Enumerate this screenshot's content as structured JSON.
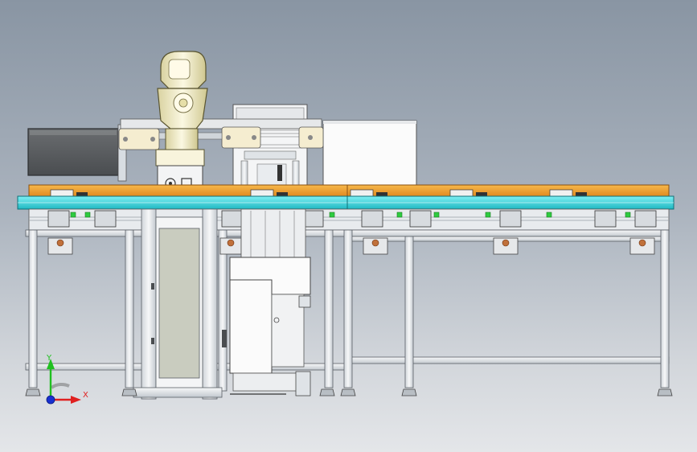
{
  "axes": {
    "x_label": "X",
    "y_label": "Y",
    "x_color": "#e02020",
    "y_color": "#20c020",
    "origin_color": "#1830d0"
  },
  "colors": {
    "background_top": "#8995a3",
    "background_bottom": "#e4e6e9",
    "frame_aluminum": "#eef0f2",
    "frame_outline": "#5a5f66",
    "conveyor_belt": "#f0a030",
    "conveyor_rail": "#29d0d8",
    "robot_body": "#f2edc8",
    "cabinet": "#fafafa",
    "indicator_green": "#2ecc40",
    "motor_copper": "#c0703a"
  },
  "icons": [
    "robot-arm-icon",
    "axis-triad-icon"
  ]
}
